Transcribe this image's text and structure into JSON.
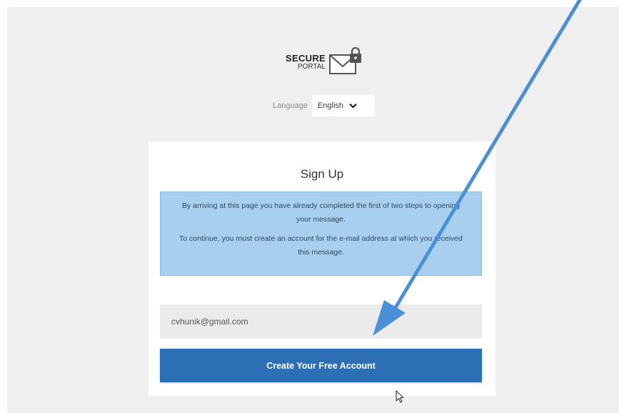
{
  "logo": {
    "line1": "SECURE",
    "line2": "PORTAL",
    "icon": "envelope-lock-icon"
  },
  "language": {
    "label": "Language",
    "selected": "English",
    "icon": "chevron-down-icon"
  },
  "signup": {
    "title": "Sign Up",
    "info_paragraph_1": "By arriving at this page you have already completed the first of two steps to opening your message.",
    "info_paragraph_2": "To continue, you must create an account for the e-mail address at which you received this message.",
    "email_value": "cvhunik@gmail.com",
    "button_label": "Create Your Free Account"
  },
  "annotation": {
    "arrow_color": "#4a90d9",
    "icon": "annotation-arrow-icon"
  },
  "colors": {
    "button": "#2c6fb4",
    "info_box": "#a8cfee",
    "background": "#efefef"
  }
}
